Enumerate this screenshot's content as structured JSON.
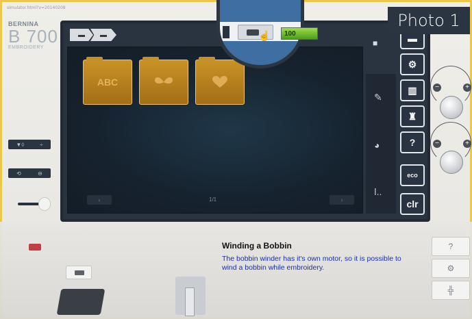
{
  "sim": {
    "top_filename": "simulator.html?v=20140208",
    "brand": {
      "line1": "BERNINA",
      "line2": "B 700",
      "line3": "EMBROIDERY"
    },
    "photo_label": "Photo 1"
  },
  "left_controls": {
    "row1": [
      "▼◊",
      "÷"
    ],
    "row2": [
      "⟲",
      "⊖"
    ]
  },
  "toolbar": {
    "folder_icons": [
      "folder-icon",
      "folder-icon"
    ],
    "right_icon": "folder-icon",
    "progress_label": "100",
    "progress_fraction": 1.0
  },
  "workarea": {
    "tiles": [
      {
        "label": "ABC",
        "icon": "text-design"
      },
      {
        "label": "",
        "icon": "butterfly-design"
      },
      {
        "label": "",
        "icon": "heart-design"
      }
    ],
    "page_indicator": "1/1"
  },
  "side_buttons": [
    {
      "label": "⚙",
      "name": "settings"
    },
    {
      "label": "📖",
      "name": "tutorial"
    },
    {
      "label": "👗",
      "name": "creative-consultant"
    },
    {
      "label": "?",
      "name": "help"
    },
    {
      "label": "eco",
      "name": "eco"
    },
    {
      "label": "clr",
      "name": "clear"
    }
  ],
  "magnifier": {
    "hint": "bobbin winder button"
  },
  "message": {
    "title": "Winding a Bobbin",
    "body": "The bobbin winder has it's own motor, so it is possible to wind a bobbin while embroidery."
  },
  "bottom_panel": {
    "help": "?",
    "settings": "⚙",
    "needle": "╬"
  },
  "colors": {
    "accent_gold": "#c99227",
    "screen_bg": "#2a3340",
    "message_body": "#1c2fa6",
    "frame_border": "#e9c84a"
  }
}
